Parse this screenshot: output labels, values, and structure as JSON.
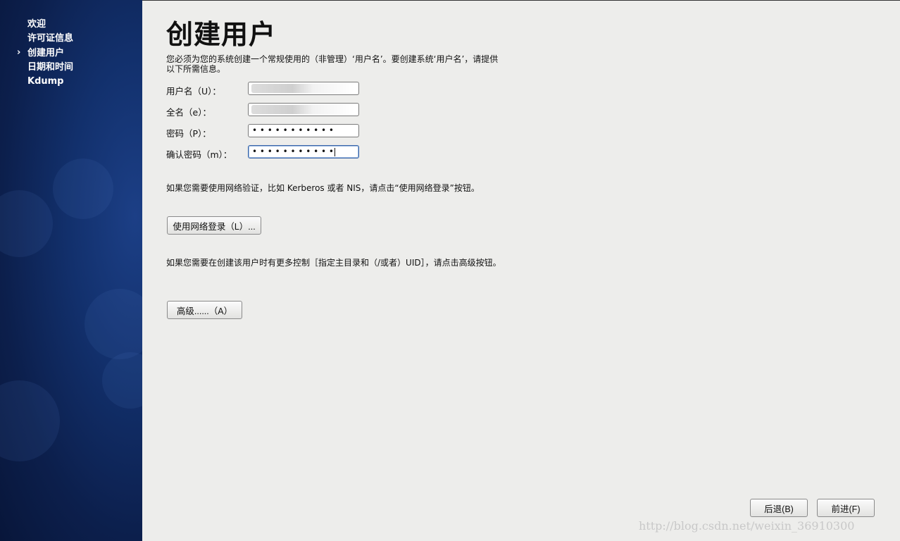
{
  "sidebar": {
    "items": [
      {
        "label": "欢迎"
      },
      {
        "label": "许可证信息"
      },
      {
        "label": "创建用户"
      },
      {
        "label": "日期和时间"
      },
      {
        "label": "Kdump"
      }
    ],
    "current_index": 2
  },
  "page": {
    "title": "创建用户",
    "intro": "您必须为您的系统创建一个常规使用的（非管理）‘用户名’。要创建系统‘用户名’，请提供以下所需信息。",
    "fields": {
      "username": {
        "label": "用户名（U）："
      },
      "fullname": {
        "label": "全名（e）："
      },
      "password": {
        "label": "密码（P）：",
        "value": "• • • • • • • • • • •"
      },
      "confirm": {
        "label": "确认密码（m）：",
        "value": "• • • • • • • • • • •"
      }
    },
    "network_text": "如果您需要使用网络验证，比如 Kerberos 或者 NIS，请点击“使用网络登录”按钮。",
    "network_button": "使用网络登录（L）...",
    "advanced_text": "如果您需要在创建该用户时有更多控制［指定主目录和（/或者）UID］，请点击高级按钮。",
    "advanced_button": "高级......（A）"
  },
  "nav": {
    "back": "后退(B)",
    "forward": "前进(F)"
  },
  "watermark": "http://blog.csdn.net/weixin_36910300"
}
